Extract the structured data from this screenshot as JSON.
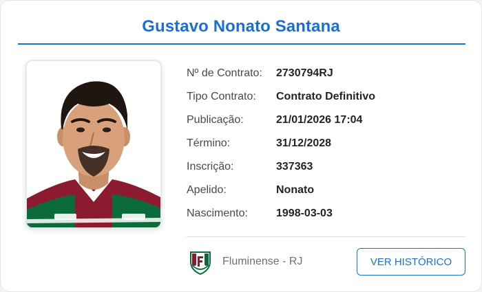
{
  "player": {
    "name": "Gustavo Nonato Santana"
  },
  "details": [
    {
      "label": "Nº de Contrato:",
      "value": "2730794RJ"
    },
    {
      "label": "Tipo Contrato:",
      "value": "Contrato Definitivo"
    },
    {
      "label": "Publicação:",
      "value": "21/01/2026 17:04"
    },
    {
      "label": "Término:",
      "value": "31/12/2028"
    },
    {
      "label": "Inscrição:",
      "value": "337363"
    },
    {
      "label": "Apelido:",
      "value": "Nonato"
    },
    {
      "label": "Nascimento:",
      "value": "1998-03-03"
    }
  ],
  "club": {
    "name": "Fluminense - RJ",
    "crest_icon": "fluminense-crest-icon"
  },
  "actions": {
    "history_label": "VER HISTÓRICO"
  },
  "colors": {
    "accent": "#1a6fd6",
    "club_green": "#0b6b3a",
    "club_maroon": "#8c1b2f"
  }
}
